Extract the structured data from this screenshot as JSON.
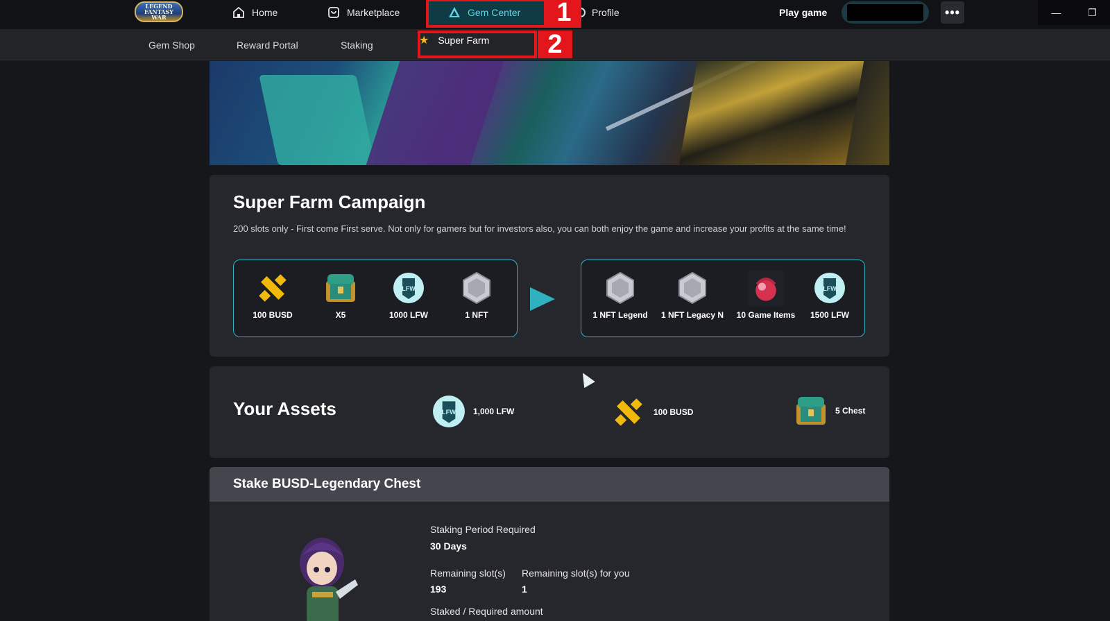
{
  "topbar": {
    "logo_text": "LEGEND FANTASY WAR",
    "nav": [
      {
        "label": "Home",
        "icon": "home-icon"
      },
      {
        "label": "Marketplace",
        "icon": "shop-icon"
      },
      {
        "label": "Gem Center",
        "icon": "gem-icon",
        "active": true
      },
      {
        "label": "Profile",
        "icon": "profile-icon"
      }
    ],
    "play_game_label": "Play game",
    "menu_label": "•••",
    "annotation_1": "1"
  },
  "subnav": {
    "items": [
      {
        "label": "Gem Shop"
      },
      {
        "label": "Reward Portal"
      },
      {
        "label": "Staking"
      },
      {
        "label": "Super Farm",
        "active": true,
        "icon": "star-icon"
      }
    ],
    "annotation_2": "2"
  },
  "campaign": {
    "title": "Super Farm Campaign",
    "description": "200 slots only - First come First serve. Not only for gamers but for investors also, you can both enjoy the game and increase your profits at the same time!",
    "inputs": [
      {
        "label": "100 BUSD",
        "icon": "busd-icon"
      },
      {
        "label": "X5",
        "icon": "chest-icon"
      },
      {
        "label": "1000 LFW",
        "icon": "lfw-icon"
      },
      {
        "label": "1 NFT",
        "icon": "nft-icon"
      }
    ],
    "outputs": [
      {
        "label": "1 NFT Legend",
        "icon": "nft-icon"
      },
      {
        "label": "1 NFT Legacy N",
        "icon": "nft-icon"
      },
      {
        "label": "10 Game Items",
        "icon": "game-item-icon"
      },
      {
        "label": "1500 LFW",
        "icon": "lfw-icon"
      }
    ]
  },
  "assets": {
    "title": "Your Assets",
    "items": [
      {
        "label": "1,000 LFW",
        "icon": "lfw-icon"
      },
      {
        "label": "100 BUSD",
        "icon": "busd-icon"
      },
      {
        "label": "5 Chest",
        "icon": "chest-icon"
      }
    ]
  },
  "stake": {
    "title": "Stake BUSD-Legendary Chest",
    "period_label": "Staking Period Required",
    "period_value": "30 Days",
    "remaining_label": "Remaining slot(s)",
    "remaining_value": "193",
    "remaining_you_label": "Remaining slot(s) for you",
    "remaining_you_value": "1",
    "staked_label": "Staked / Required amount"
  },
  "colors": {
    "accent": "#2fb1c0",
    "highlight": "#e3161b",
    "busd": "#f0b90b",
    "background": "#16171b",
    "card": "#26272d"
  }
}
